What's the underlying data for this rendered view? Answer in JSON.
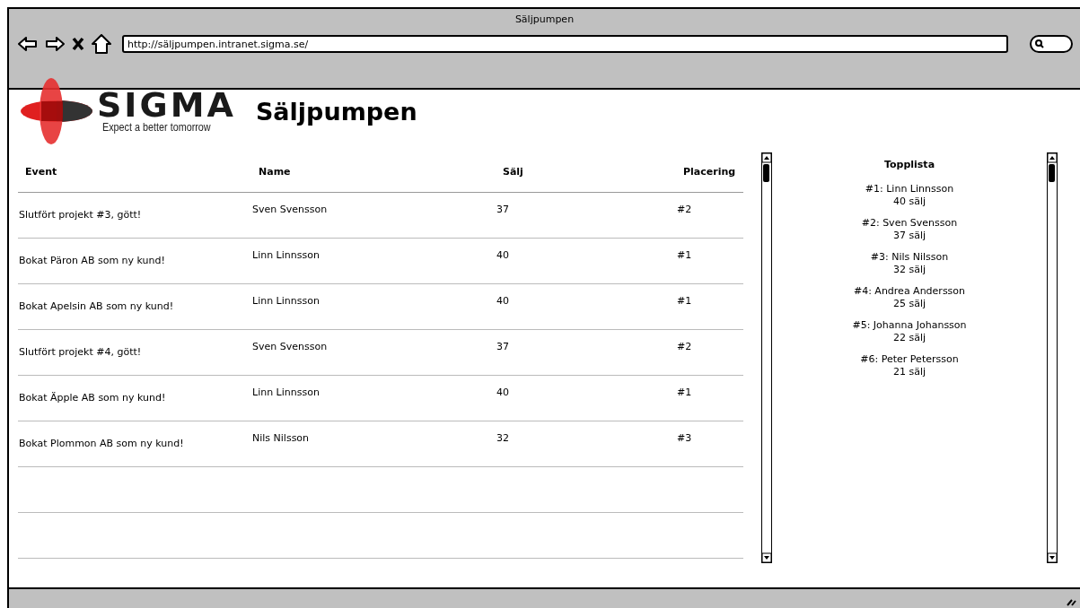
{
  "window": {
    "title": "Säljpumpen"
  },
  "browser": {
    "url": "http://säljpumpen.intranet.sigma.se/"
  },
  "logo": {
    "wordmark": "SIGMA",
    "tagline": "Expect a better tomorrow"
  },
  "page_title": "Säljpumpen",
  "table": {
    "columns": [
      "Event",
      "Name",
      "Sälj",
      "Placering"
    ],
    "rows": [
      {
        "event": "Slutfört projekt #3, gött!",
        "name": "Sven Svensson",
        "salj": "37",
        "placering": "#2"
      },
      {
        "event": "Bokat Päron AB som ny kund!",
        "name": "Linn Linnsson",
        "salj": "40",
        "placering": "#1"
      },
      {
        "event": "Bokat Apelsin AB som ny kund!",
        "name": "Linn Linnsson",
        "salj": "40",
        "placering": "#1"
      },
      {
        "event": "Slutfört projekt #4, gött!",
        "name": "Sven Svensson",
        "salj": "37",
        "placering": "#2"
      },
      {
        "event": "Bokat Äpple AB som ny kund!",
        "name": "Linn Linnsson",
        "salj": "40",
        "placering": "#1"
      },
      {
        "event": "Bokat Plommon AB som ny kund!",
        "name": "Nils Nilsson",
        "salj": "32",
        "placering": "#3"
      }
    ]
  },
  "topplista": {
    "title": "Topplista",
    "entries": [
      {
        "name": "#1: Linn Linnsson",
        "score": "40 sälj"
      },
      {
        "name": "#2: Sven Svensson",
        "score": "37 sälj"
      },
      {
        "name": "#3: Nils Nilsson",
        "score": "32 sälj"
      },
      {
        "name": "#4: Andrea Andersson",
        "score": "25 sälj"
      },
      {
        "name": "#5: Johanna Johansson",
        "score": "22 sälj"
      },
      {
        "name": "#6: Peter Petersson",
        "score": "21 sälj"
      }
    ]
  }
}
